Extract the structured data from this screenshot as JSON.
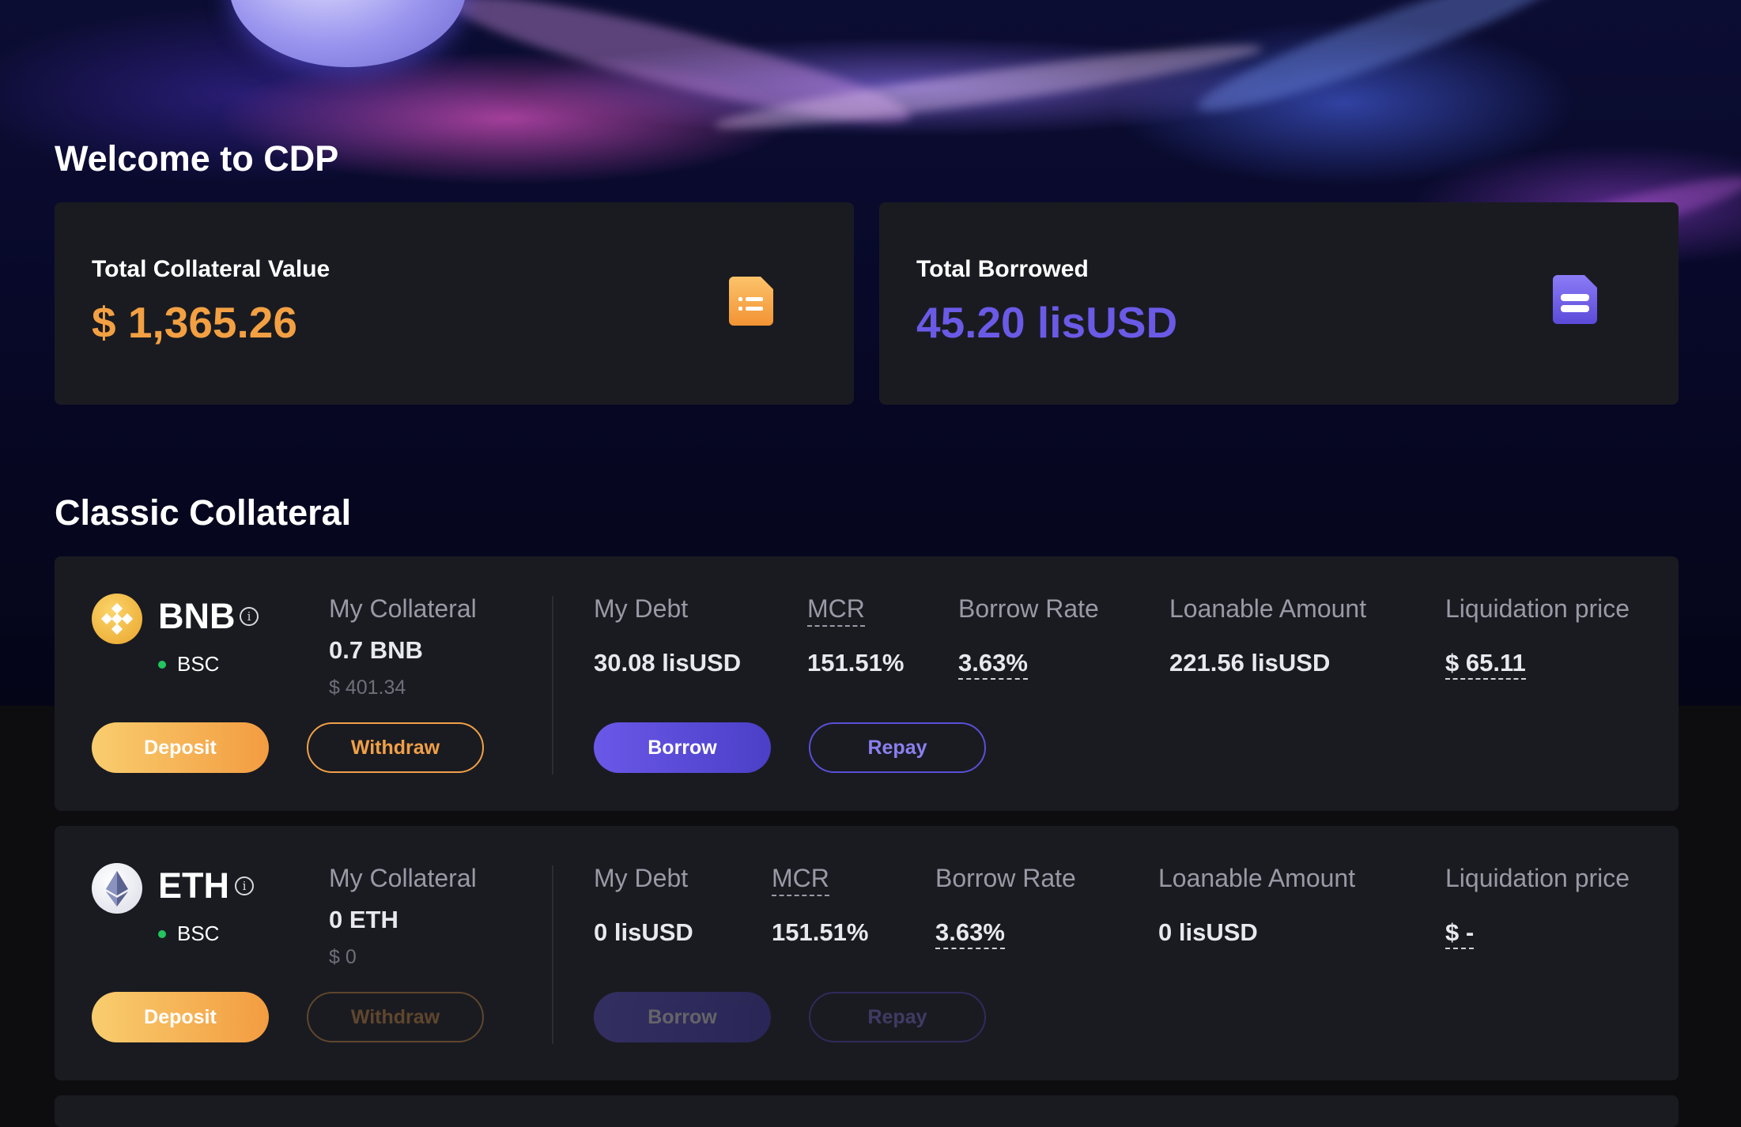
{
  "page": {
    "title": "Welcome to CDP",
    "section_title": "Classic Collateral"
  },
  "summary": {
    "collateral": {
      "label": "Total Collateral Value",
      "value": "$ 1,365.26",
      "color": "#f3a043",
      "icon": "orange-document-icon"
    },
    "borrowed": {
      "label": "Total Borrowed",
      "value": "45.20 lisUSD",
      "color": "#6a5ae6",
      "icon": "purple-document-icon"
    }
  },
  "assets": [
    {
      "name": "BNB",
      "chain": "BSC",
      "logo": "bnb-logo",
      "labels": {
        "collateral": "My Collateral",
        "debt": "My Debt",
        "mcr": "MCR",
        "rate": "Borrow Rate",
        "loanable": "Loanable Amount",
        "liquidation": "Liquidation price"
      },
      "collateral_amount": "0.7 BNB",
      "collateral_usd": "$ 401.34",
      "debt": "30.08 lisUSD",
      "mcr": "151.51%",
      "rate": "3.63%",
      "loanable": "221.56 lisUSD",
      "liquidation": "$ 65.11",
      "buttons": {
        "deposit": "Deposit",
        "withdraw": "Withdraw",
        "borrow": "Borrow",
        "repay": "Repay"
      },
      "enabled": {
        "withdraw": true,
        "borrow": true,
        "repay": true
      }
    },
    {
      "name": "ETH",
      "chain": "BSC",
      "logo": "eth-logo",
      "labels": {
        "collateral": "My Collateral",
        "debt": "My Debt",
        "mcr": "MCR",
        "rate": "Borrow Rate",
        "loanable": "Loanable Amount",
        "liquidation": "Liquidation price"
      },
      "collateral_amount": "0 ETH",
      "collateral_usd": "$ 0",
      "debt": "0 lisUSD",
      "mcr": "151.51%",
      "rate": "3.63%",
      "loanable": "0 lisUSD",
      "liquidation": "$ -",
      "buttons": {
        "deposit": "Deposit",
        "withdraw": "Withdraw",
        "borrow": "Borrow",
        "repay": "Repay"
      },
      "enabled": {
        "withdraw": false,
        "borrow": false,
        "repay": false
      }
    }
  ]
}
